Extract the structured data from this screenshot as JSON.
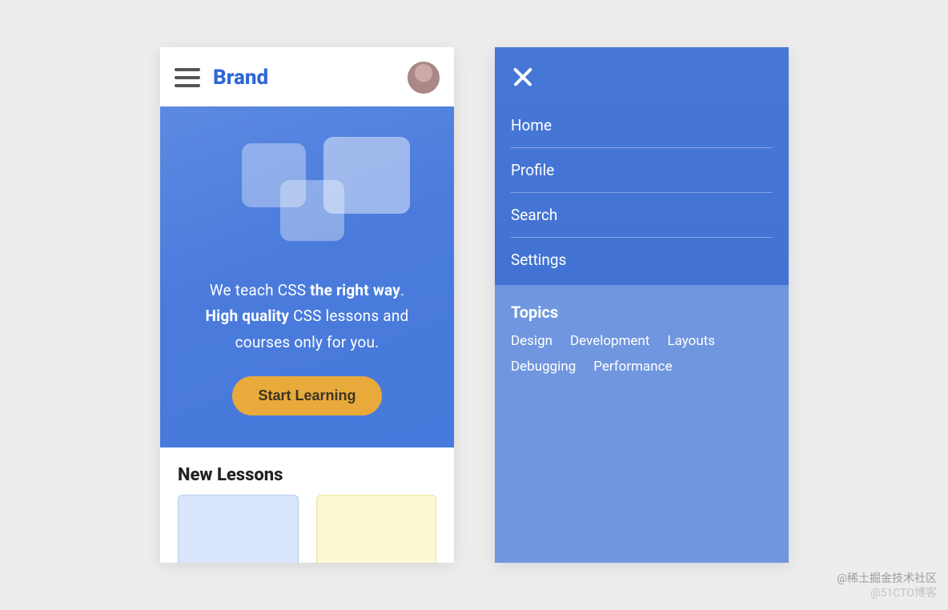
{
  "header": {
    "brand": "Brand"
  },
  "hero": {
    "line1_pre": "We teach CSS ",
    "line1_bold": "the right way",
    "line1_post": ".",
    "line2_bold": "High quality",
    "line2_rest": " CSS lessons and courses only for you.",
    "cta": "Start Learning"
  },
  "lessons": {
    "title": "New Lessons"
  },
  "nav": {
    "items": [
      "Home",
      "Profile",
      "Search",
      "Settings"
    ]
  },
  "topics": {
    "title": "Topics",
    "tags": [
      "Design",
      "Development",
      "Layouts",
      "Debugging",
      "Performance"
    ]
  },
  "watermarks": {
    "line1": "@稀土掘金技术社区",
    "line2": "@51CTO博客"
  }
}
